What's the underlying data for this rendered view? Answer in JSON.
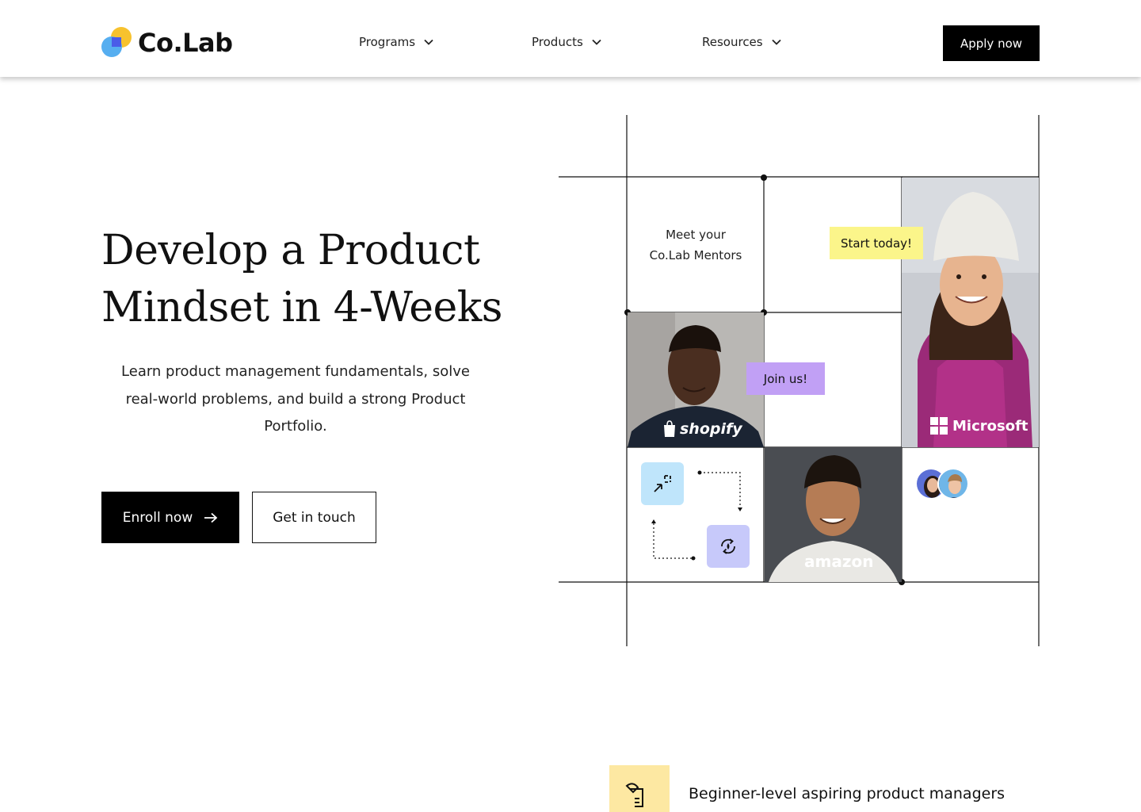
{
  "header": {
    "logo_text": "Co.Lab",
    "nav": [
      {
        "label": "Programs"
      },
      {
        "label": "Products"
      },
      {
        "label": "Resources"
      }
    ],
    "apply_label": "Apply now"
  },
  "hero": {
    "title_line1": "Develop a Product",
    "title_line2": "Mindset in 4-Weeks",
    "subtitle": "Learn product management fundamentals, solve real-world problems, and build a strong Product Portfolio.",
    "enroll_label": "Enroll now",
    "contact_label": "Get in touch"
  },
  "mentors": {
    "meet_line1": "Meet your",
    "meet_line2": "Co.Lab Mentors",
    "start_tag": "Start today!",
    "join_tag": "Join us!",
    "brands": [
      "shopify",
      "Microsoft",
      "amazon"
    ]
  },
  "feature": {
    "text": "Beginner-level aspiring product managers"
  },
  "colors": {
    "accent_yellow": "#fbf58a",
    "accent_purple": "#c1a0f5",
    "icon_blue": "#bfe5fb",
    "icon_lavender": "#c7c9fa",
    "feature_yellow": "#fde8a2",
    "primary_black": "#000000"
  }
}
